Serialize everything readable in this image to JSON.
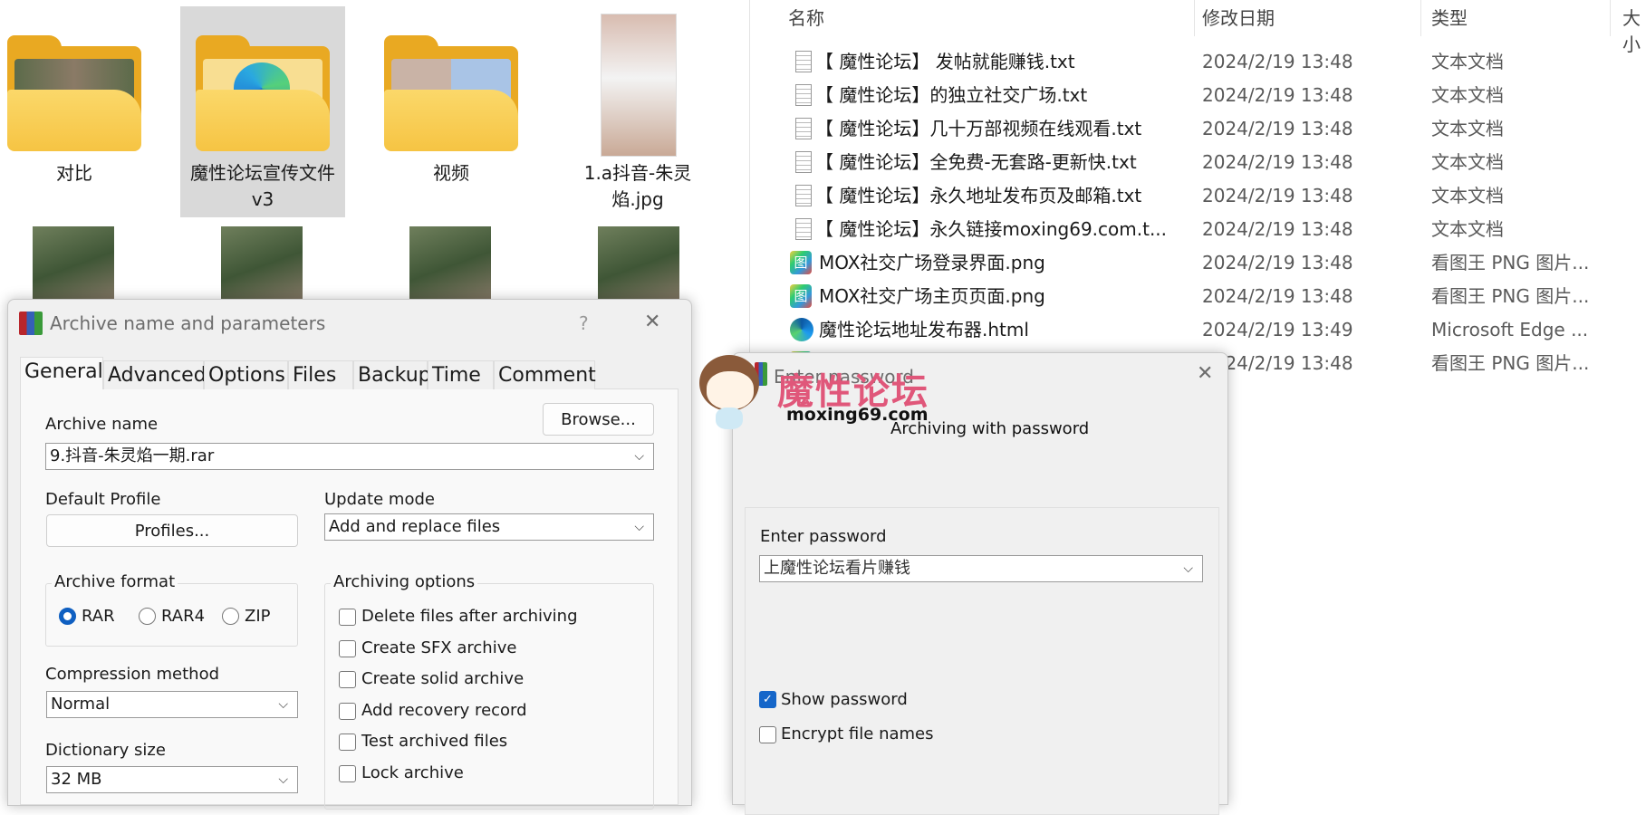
{
  "explorer_icons": {
    "items": [
      {
        "label": "对比",
        "type": "folder"
      },
      {
        "label": "魔性论坛宣传文件v3",
        "type": "folder",
        "selected": true
      },
      {
        "label": "视频",
        "type": "folder"
      },
      {
        "label": "1.a抖音-朱灵焰.jpg",
        "type": "image"
      }
    ]
  },
  "explorer_details": {
    "columns": [
      "名称",
      "修改日期",
      "类型",
      "大小"
    ],
    "rows": [
      {
        "name": "【 魔性论坛】 发帖就能赚钱.txt",
        "date": "2024/2/19 13:48",
        "type": "文本文档",
        "icon": "text-file-icon"
      },
      {
        "name": "【 魔性论坛】的独立社交广场.txt",
        "date": "2024/2/19 13:48",
        "type": "文本文档",
        "icon": "text-file-icon"
      },
      {
        "name": "【 魔性论坛】几十万部视频在线观看.txt",
        "date": "2024/2/19 13:48",
        "type": "文本文档",
        "icon": "text-file-icon"
      },
      {
        "name": "【 魔性论坛】全免费-无套路-更新快.txt",
        "date": "2024/2/19 13:48",
        "type": "文本文档",
        "icon": "text-file-icon"
      },
      {
        "name": "【 魔性论坛】永久地址发布页及邮箱.txt",
        "date": "2024/2/19 13:48",
        "type": "文本文档",
        "icon": "text-file-icon"
      },
      {
        "name": "【 魔性论坛】永久链接moxing69.com.t...",
        "date": "2024/2/19 13:48",
        "type": "文本文档",
        "icon": "text-file-icon"
      },
      {
        "name": "MOX社交广场登录界面.png",
        "date": "2024/2/19 13:48",
        "type": "看图王 PNG 图片...",
        "icon": "image-viewer-icon"
      },
      {
        "name": "MOX社交广场主页页面.png",
        "date": "2024/2/19 13:48",
        "type": "看图王 PNG 图片...",
        "icon": "image-viewer-icon"
      },
      {
        "name": "魔性论坛地址发布器.html",
        "date": "2024/2/19 13:49",
        "type": "Microsoft Edge ...",
        "icon": "edge-icon"
      },
      {
        "name": "",
        "date": "2024/2/19 13:48",
        "type": "看图王 PNG 图片...",
        "icon": "image-viewer-icon"
      }
    ]
  },
  "archive_dialog": {
    "title": "Archive name and parameters",
    "help": "?",
    "close": "✕",
    "tabs": [
      "General",
      "Advanced",
      "Options",
      "Files",
      "Backup",
      "Time",
      "Comment"
    ],
    "active_tab": "General",
    "archive_name_label": "Archive name",
    "browse": "Browse...",
    "archive_name_value": "9.抖音-朱灵焰一期.rar",
    "default_profile_label": "Default Profile",
    "profiles": "Profiles...",
    "update_mode_label": "Update mode",
    "update_mode_value": "Add and replace files",
    "archive_format_label": "Archive format",
    "formats": [
      "RAR",
      "RAR4",
      "ZIP"
    ],
    "selected_format": "RAR",
    "compression_label": "Compression method",
    "compression_value": "Normal",
    "dictionary_label": "Dictionary size",
    "dictionary_value": "32 MB",
    "options_label": "Archiving options",
    "options": [
      {
        "label": "Delete files after archiving",
        "checked": false
      },
      {
        "label": "Create SFX archive",
        "checked": false
      },
      {
        "label": "Create solid archive",
        "checked": false
      },
      {
        "label": "Add recovery record",
        "checked": false
      },
      {
        "label": "Test archived files",
        "checked": false
      },
      {
        "label": "Lock archive",
        "checked": false
      }
    ]
  },
  "password_dialog": {
    "title": "Enter password",
    "close": "✕",
    "heading": "Archiving with password",
    "password_label": "Enter password",
    "password_value": "上魔性论坛看片赚钱",
    "show_password": {
      "label": "Show password",
      "checked": true
    },
    "encrypt_names": {
      "label": "Encrypt file names",
      "checked": false
    }
  },
  "watermark": {
    "text": "魔性论坛",
    "url": "moxing69.com",
    "color": "#e0577a"
  },
  "colors": {
    "accent": "#1566c9",
    "selection": "#d9d9d9",
    "folder": "#f6c443"
  }
}
